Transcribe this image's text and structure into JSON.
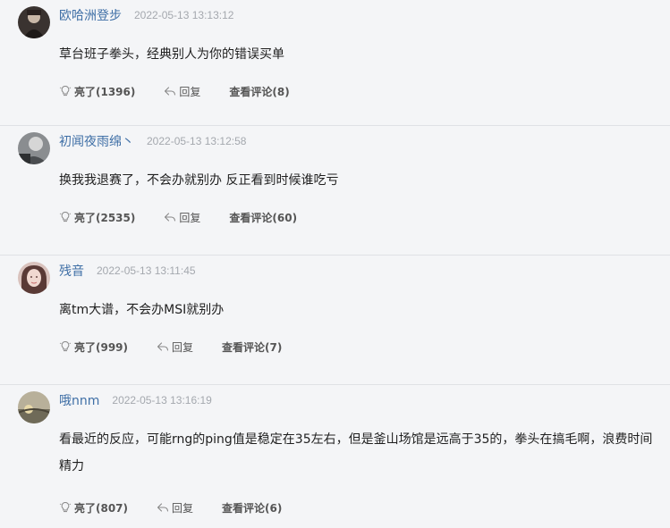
{
  "comments": [
    {
      "username": "欧哈洲登步",
      "time": "2022-05-13 13:13:12",
      "content": "草台班子拳头，经典别人为你的错误买单",
      "like_label": "亮了(1396)",
      "reply_label": "回复",
      "view_replies_label": "查看评论(8)",
      "avatar_icon": "avatar-dark-figure"
    },
    {
      "username": "初闻夜雨绵丶",
      "time": "2022-05-13 13:12:58",
      "content": "换我我退赛了，不会办就别办 反正看到时候谁吃亏",
      "like_label": "亮了(2535)",
      "reply_label": "回复",
      "view_replies_label": "查看评论(60)",
      "avatar_icon": "avatar-grey-figure"
    },
    {
      "username": "残音",
      "time": "2022-05-13 13:11:45",
      "content": "离tm大谱，不会办MSI就别办",
      "like_label": "亮了(999)",
      "reply_label": "回复",
      "view_replies_label": "查看评论(7)",
      "avatar_icon": "avatar-portrait"
    },
    {
      "username": "哦nnm",
      "time": "2022-05-13 13:16:19",
      "content": "看最近的反应，可能rng的ping值是稳定在35左右，但是釜山场馆是远高于35的，拳头在搞毛啊，浪费时间精力",
      "like_label": "亮了(807)",
      "reply_label": "回复",
      "view_replies_label": "查看评论(6)",
      "avatar_icon": "avatar-landscape"
    }
  ],
  "icons": {
    "like": "lightbulb-icon",
    "reply": "reply-arrow-icon"
  },
  "colors": {
    "username": "#3f6fa6",
    "timestamp": "#a4a8ae",
    "background": "#f4f5f7"
  }
}
